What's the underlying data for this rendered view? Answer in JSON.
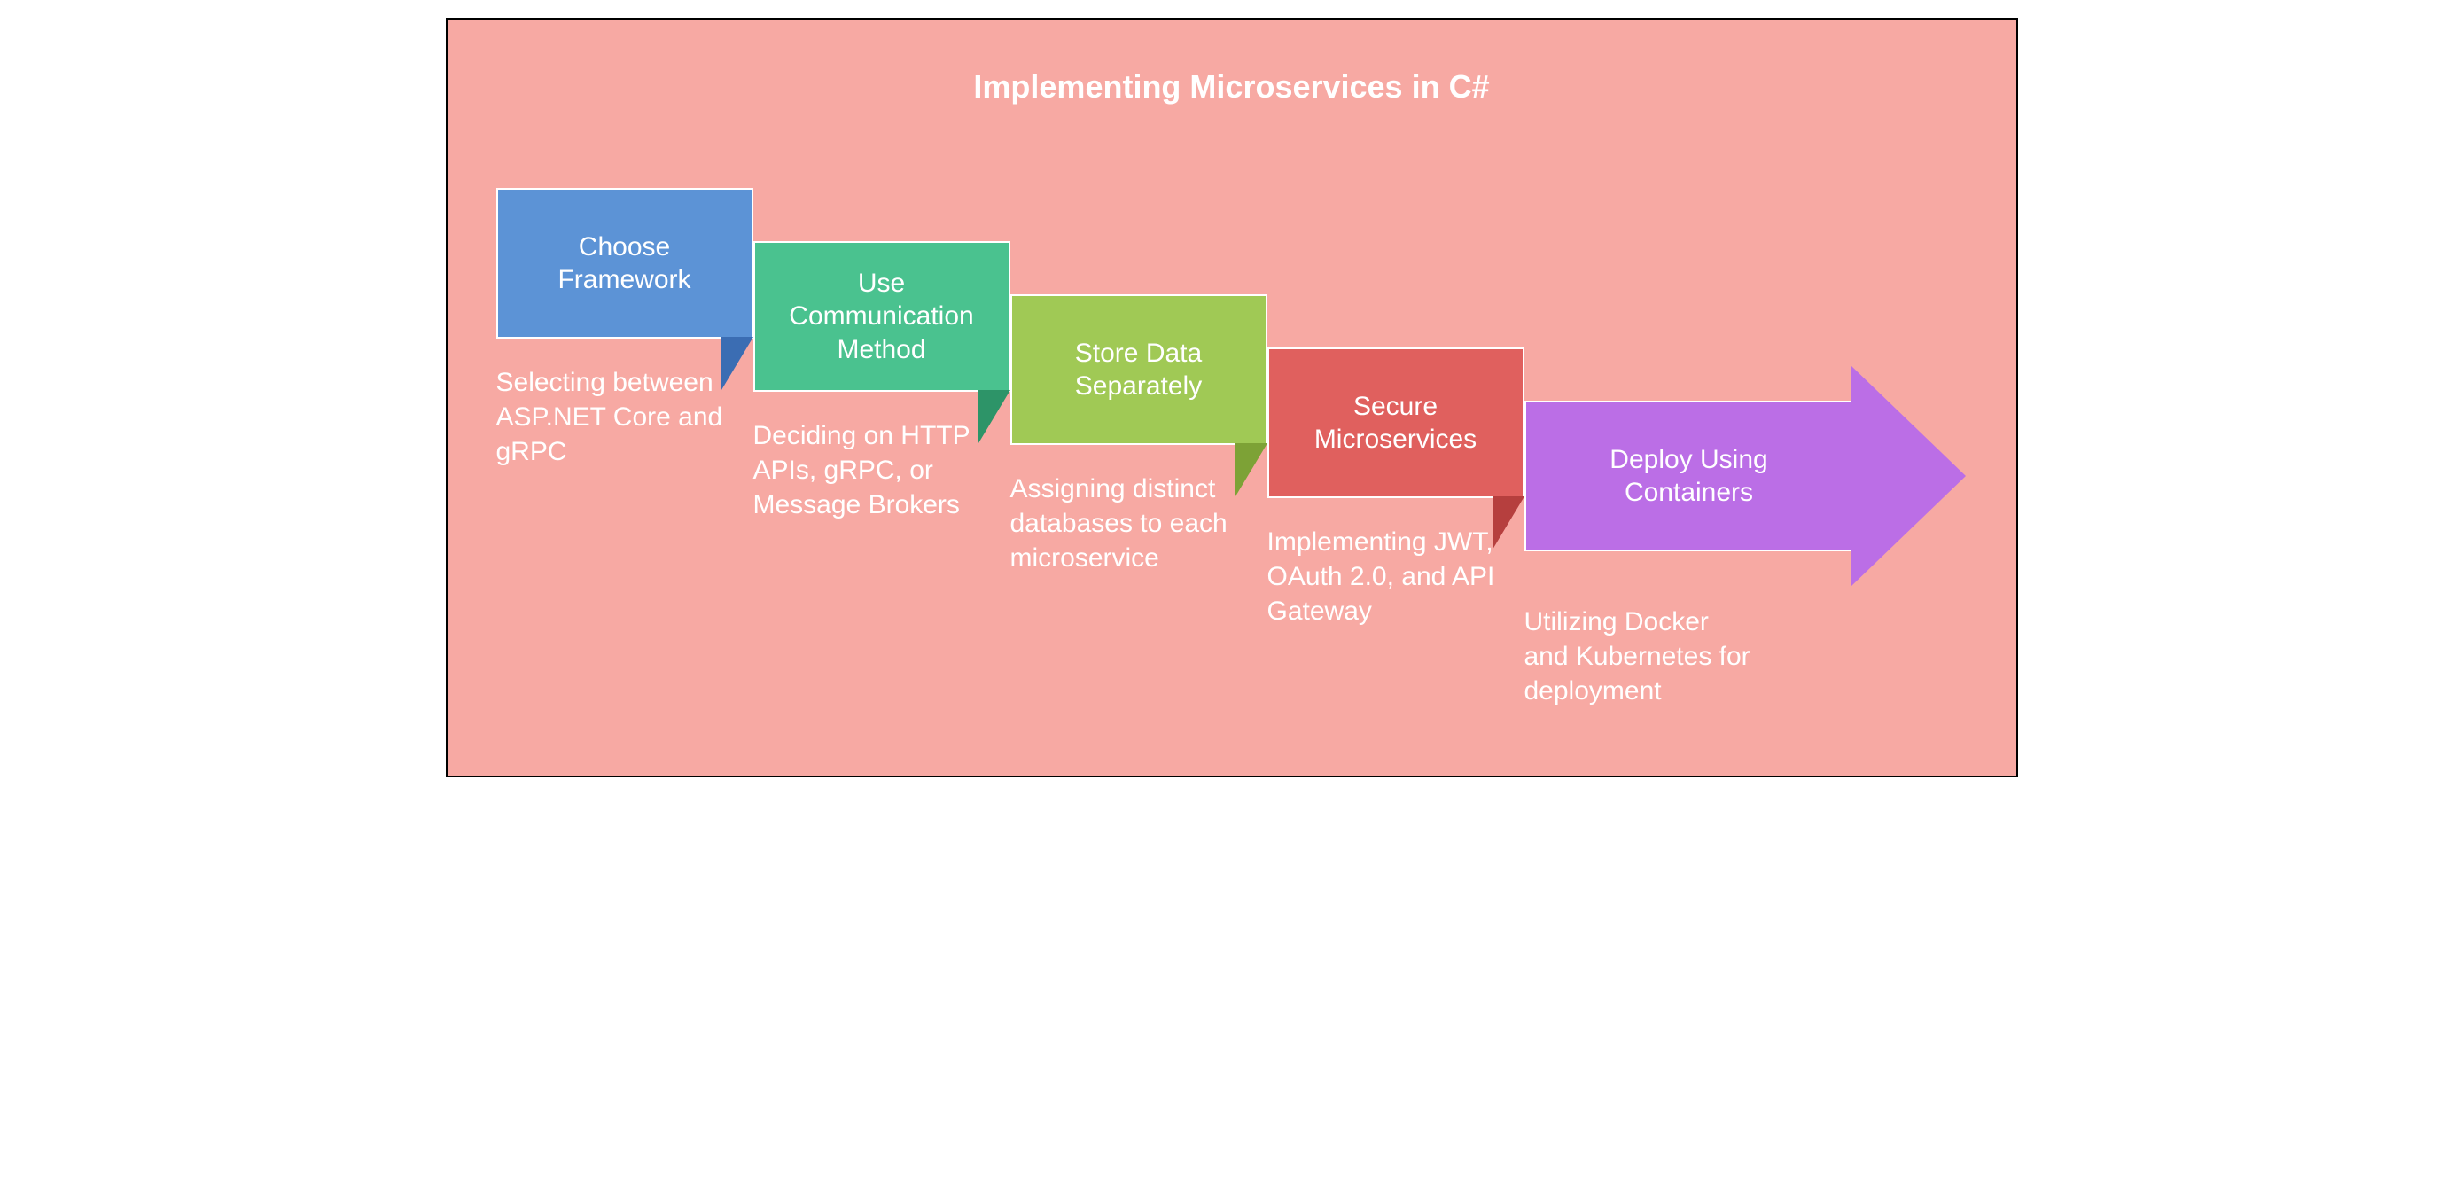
{
  "title": "Implementing Microservices in C#",
  "steps": [
    {
      "label": "Choose Framework",
      "desc": "Selecting between ASP.NET Core and gRPC",
      "color": "#5c93d6"
    },
    {
      "label": "Use Communication Method",
      "desc": "Deciding on HTTP APIs, gRPC, or Message Brokers",
      "color": "#4ac28f"
    },
    {
      "label": "Store Data Separately",
      "desc": "Assigning distinct databases to each microservice",
      "color": "#a0c955"
    },
    {
      "label": "Secure Microservices",
      "desc": "Implementing JWT, OAuth 2.0, and API Gateway",
      "color": "#e0605e"
    },
    {
      "label": "Deploy Using Containers",
      "desc": "Utilizing Docker and Kubernetes for deployment",
      "color": "#bb6ee6"
    }
  ]
}
